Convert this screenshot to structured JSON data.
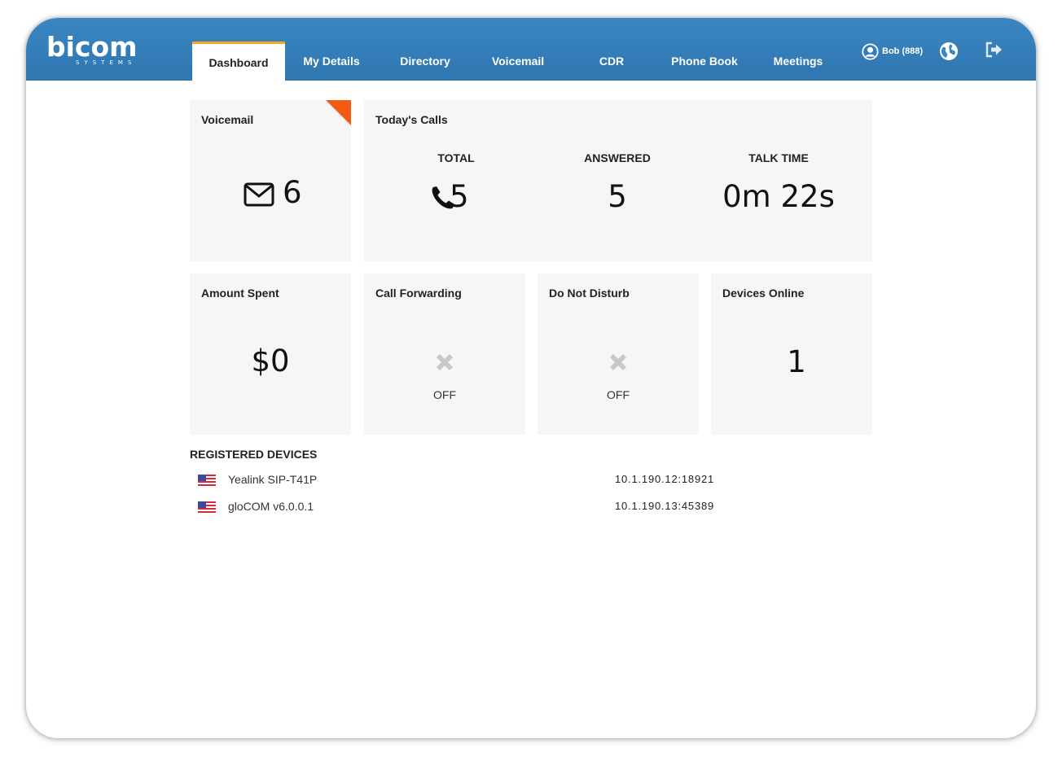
{
  "brand": {
    "name": "bicom",
    "sub": "SYSTEMS"
  },
  "nav": {
    "tabs": [
      {
        "label": "Dashboard",
        "active": true
      },
      {
        "label": "My Details"
      },
      {
        "label": "Directory"
      },
      {
        "label": "Voicemail"
      },
      {
        "label": "CDR"
      },
      {
        "label": "Phone Book"
      },
      {
        "label": "Meetings"
      }
    ],
    "user": {
      "name": "Bob",
      "ext": "(888)",
      "display": "Bob (888)"
    },
    "icons": [
      "user-icon",
      "globe-icon",
      "logout-icon"
    ]
  },
  "cards": {
    "voicemail": {
      "title": "Voicemail",
      "count": "6",
      "icon": "envelope-icon"
    },
    "todays_calls": {
      "title": "Today's Calls",
      "columns": [
        {
          "label": "TOTAL",
          "value": "5",
          "icon": "phone-icon"
        },
        {
          "label": "ANSWERED",
          "value": "5"
        },
        {
          "label": "TALK TIME",
          "value": "0m 22s"
        }
      ]
    },
    "amount_spent": {
      "title": "Amount Spent",
      "value": "$0"
    },
    "call_forwarding": {
      "title": "Call Forwarding",
      "status": "OFF",
      "icon": "x-icon"
    },
    "do_not_disturb": {
      "title": "Do Not Disturb",
      "status": "OFF",
      "icon": "x-icon"
    },
    "devices_online": {
      "title": "Devices Online",
      "value": "1"
    }
  },
  "registered_devices": {
    "title": "REGISTERED DEVICES",
    "rows": [
      {
        "name": "Yealink SIP-T41P",
        "ip": "10.1.190.12:18921",
        "flag": "us-flag-icon"
      },
      {
        "name": "gloCOM v6.0.0.1",
        "ip": "10.1.190.13:45389",
        "flag": "us-flag-icon"
      }
    ]
  },
  "colors": {
    "header": "#2f76b0",
    "active_tab_accent": "#f7a81b",
    "voicemail_corner": "#f35a14",
    "card_bg": "#f6f6f6"
  }
}
